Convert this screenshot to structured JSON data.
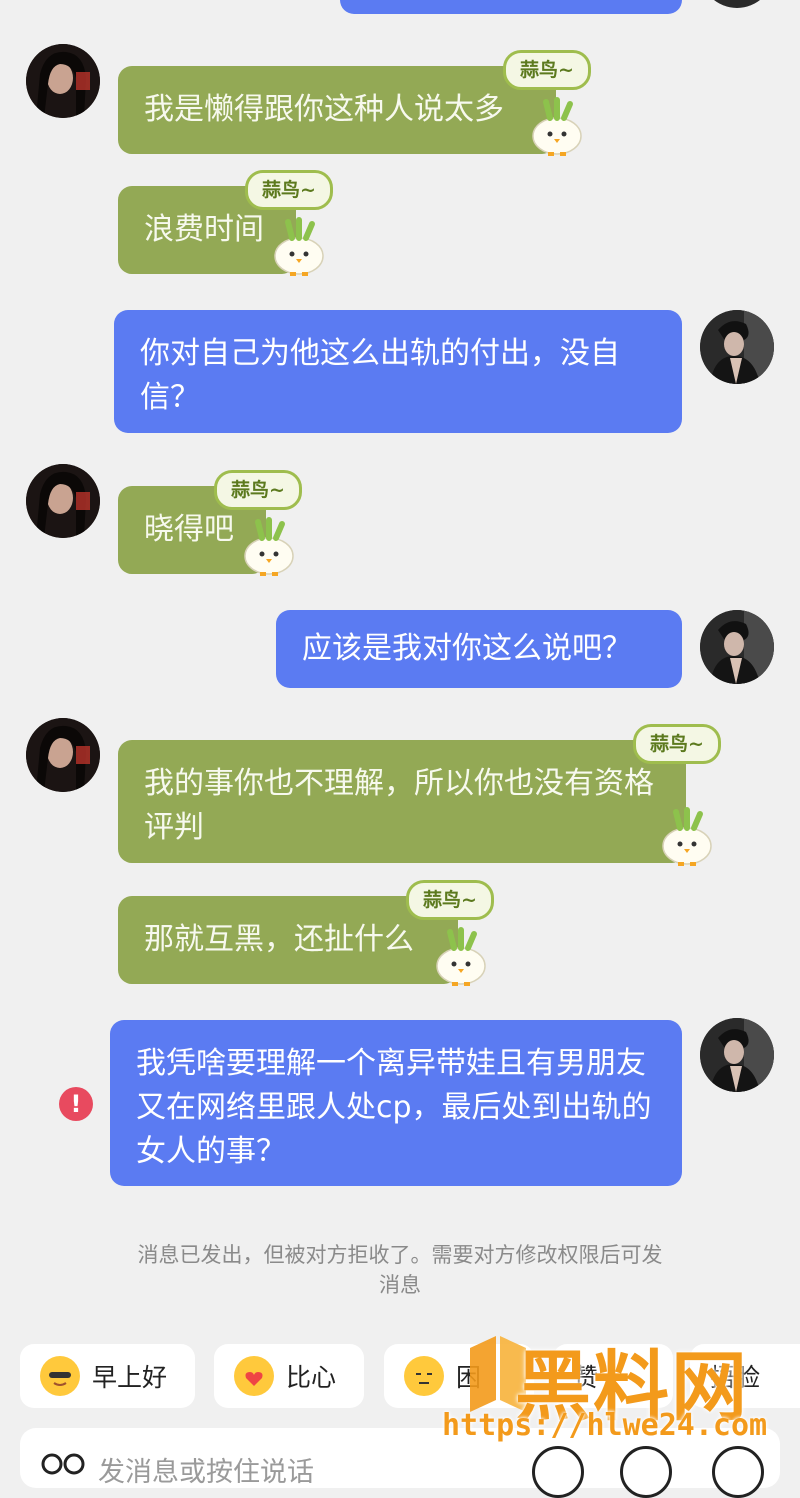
{
  "messages": [
    {
      "side": "left",
      "text": "我是懒得跟你这种人说太多",
      "tag": "蒜鸟~"
    },
    {
      "side": "left",
      "text": "浪费时间",
      "tag": "蒜鸟~"
    },
    {
      "side": "right",
      "text": "你对自己为他这么出轨的付出，没自信？"
    },
    {
      "side": "left",
      "text": "晓得吧",
      "tag": "蒜鸟~"
    },
    {
      "side": "right",
      "text": "应该是我对你这么说吧？"
    },
    {
      "side": "left",
      "text": "我的事你也不理解，所以你也没有资格评判",
      "tag": "蒜鸟~"
    },
    {
      "side": "left",
      "text": "那就互黑，还扯什么",
      "tag": "蒜鸟~"
    },
    {
      "side": "right",
      "text": "我凭啥要理解一个离异带娃且有男朋友又在网络里跟人处cp，最后处到出轨的女人的事？",
      "error": true
    }
  ],
  "error_mark": "!",
  "notice": "消息已发出，但被对方拒收了。需要对方修改权限后可发消息",
  "quick_replies": [
    {
      "label": "早上好",
      "icon": "sun-sunglasses-emoji-icon"
    },
    {
      "label": "比心",
      "icon": "heart-hand-emoji-icon"
    },
    {
      "label": "困",
      "icon": "sleepy-emoji-icon"
    },
    {
      "label": "赞",
      "icon": "thumbs-up-emoji-icon"
    },
    {
      "label": "捂脸",
      "icon": "facepalm-emoji-icon"
    }
  ],
  "input": {
    "placeholder": "发消息或按住说话"
  },
  "watermark": {
    "text": "黑料网",
    "url": "https://hlwe24.com"
  },
  "colors": {
    "received_bubble": "#93a955",
    "sent_bubble": "#5b7bf2",
    "error": "#e84a5f",
    "background": "#f0f0f0"
  }
}
